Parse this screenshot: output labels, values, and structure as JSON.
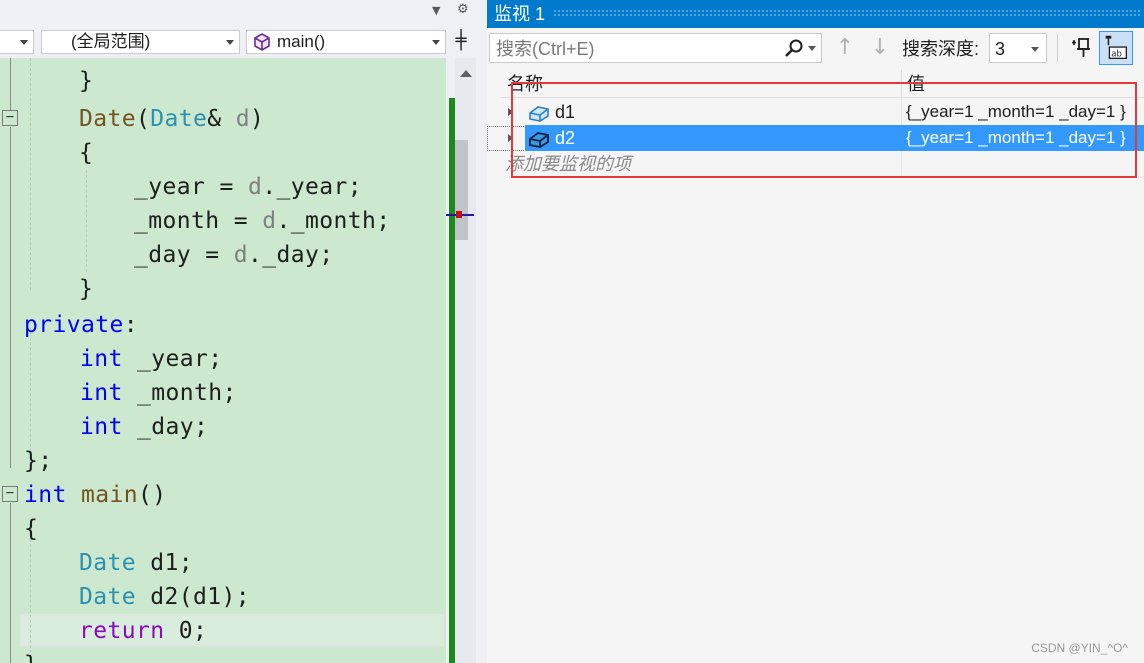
{
  "editor": {
    "scope_dropdown": "(全局范围)",
    "function_dropdown": "main()",
    "code_lines": {
      "l0": "}",
      "l1_fn": "Date",
      "l1_p1": "(",
      "l1_ty": "Date",
      "l1_p2": "& ",
      "l1_pa": "d",
      "l1_p3": ")",
      "l2": "{",
      "l3a": "_year = ",
      "l3b": "d",
      "l3c": "._year;",
      "l4a": "_month = ",
      "l4b": "d",
      "l4c": "._month;",
      "l5a": "_day = ",
      "l5b": "d",
      "l5c": "._day;",
      "l6": "}",
      "l7_kw": "private",
      "l7_p": ":",
      "l8_kw": "int",
      "l8_r": " _year;",
      "l9_kw": "int",
      "l9_r": " _month;",
      "l10_kw": "int",
      "l10_r": " _day;",
      "l11": "};",
      "l12_kw": "int",
      "l12_sp": " ",
      "l12_fn": "main",
      "l12_r": "()",
      "l13": "{",
      "l14_ty": "Date",
      "l14_r": " d1;",
      "l15_ty": "Date",
      "l15_r": " d2(d1);",
      "l16_kw": "return",
      "l16_r": " 0;",
      "l17": "}"
    }
  },
  "watch": {
    "title": "监视 1",
    "search_placeholder": "搜索(Ctrl+E)",
    "depth_label": "搜索深度:",
    "depth_value": "3",
    "header_name": "名称",
    "header_value": "值",
    "rows": [
      {
        "name": "d1",
        "value": "{_year=1 _month=1 _day=1 }",
        "selected": false
      },
      {
        "name": "d2",
        "value": "{_year=1 _month=1 _day=1 }",
        "selected": true
      }
    ],
    "add_watch_placeholder": "添加要监视的项"
  },
  "colors": {
    "accent": "#007acc",
    "selection": "#3399ff",
    "editor_background": "#cce8cf",
    "annotation_box": "#e5383b",
    "keyword": "#0000ff",
    "type": "#2b91af"
  },
  "icons": [
    "dropdown-arrow-icon",
    "settings-gear-icon",
    "cube-member-icon",
    "split-view-icon",
    "fold-collapse-icon",
    "search-icon",
    "arrow-up-icon",
    "arrow-down-icon",
    "pin-icon",
    "hex-display-icon",
    "expand-arrow-icon",
    "object-variable-icon"
  ],
  "watermark": "CSDN @YIN_^O^"
}
